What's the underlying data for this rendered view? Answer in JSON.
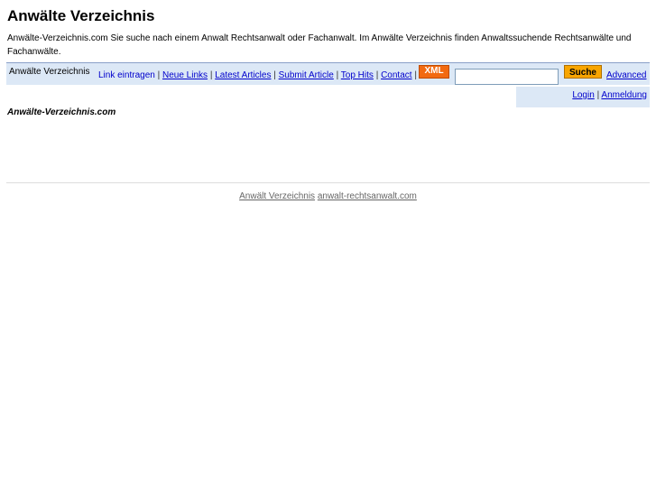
{
  "title": "Anwälte Verzeichnis",
  "description": "Anwälte-Verzeichnis.com Sie suche nach einem Anwalt Rechtsanwalt oder Fachanwalt. Im Anwälte Verzeichnis finden Anwaltssuchende Rechtsanwälte und Fachanwälte.",
  "nav": {
    "brand": "Anwälte Verzeichnis",
    "links": [
      "Link eintragen",
      "Neue Links",
      "Latest Articles",
      "Submit Article",
      "Top Hits",
      "Contact"
    ],
    "separator": "|",
    "xml": "XML",
    "search_value": "",
    "search_button": "Suche",
    "advanced": "Advanced"
  },
  "user": {
    "login": "Login",
    "separator": "|",
    "register": "Anmeldung"
  },
  "site_name": "Anwälte-Verzeichnis.com",
  "footer": {
    "link1": "Anwält Verzeichnis",
    "link2": "anwalt-rechtsanwalt.com"
  },
  "colors": {
    "bar": "#dce8f6",
    "xml": "#f26a10",
    "search_button": "#f8a500"
  }
}
